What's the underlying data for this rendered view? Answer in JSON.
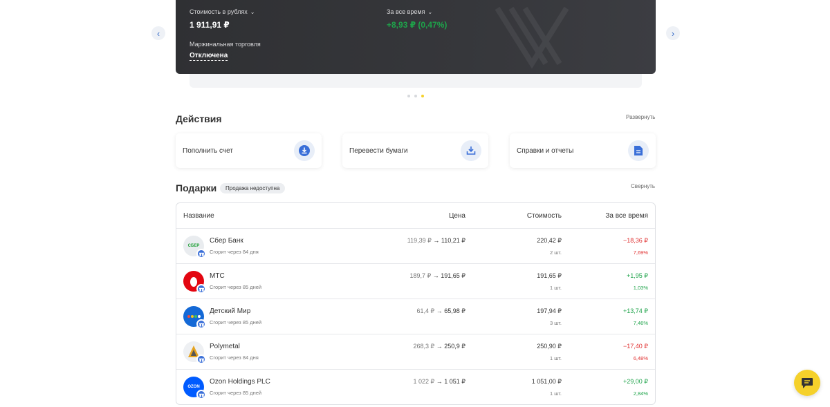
{
  "carousel": {
    "value_label": "Стоимость в рублях",
    "value": "1 911,91 ₽",
    "period_label": "За все время",
    "period_value": "+8,93 ₽ (0,47%)",
    "margin_label": "Маржинальная торговля",
    "margin_value": "Отключена",
    "active_slide": 3,
    "total_slides": 3
  },
  "actions": {
    "title": "Действия",
    "expand_label": "Развернуть",
    "items": [
      {
        "label": "Пополнить счет",
        "icon": "download-icon"
      },
      {
        "label": "Перевести бумаги",
        "icon": "transfer-in-icon"
      },
      {
        "label": "Справки и отчеты",
        "icon": "document-icon"
      }
    ]
  },
  "gifts": {
    "title": "Подарки",
    "badge": "Продажа недоступна",
    "collapse_label": "Свернуть",
    "columns": {
      "name": "Название",
      "price": "Цена",
      "cost": "Стоимость",
      "all_time": "За все время"
    },
    "rows": [
      {
        "name": "Сбер Банк",
        "sub": "Сгорит через 84 дня",
        "price_old": "119,39 ₽",
        "price_new": "110,21 ₽",
        "cost": "220,42 ₽",
        "qty": "2 шт.",
        "change": "−18,36 ₽",
        "pct": "7,69%",
        "trend": "neg",
        "logo_text": "СБЕР",
        "logo_bg": "#e9ecef",
        "logo_fg": "#21a038"
      },
      {
        "name": "МТС",
        "sub": "Сгорит через 85 дней",
        "price_old": "189,7 ₽",
        "price_new": "191,65 ₽",
        "cost": "191,65 ₽",
        "qty": "1 шт.",
        "change": "+1,95 ₽",
        "pct": "1,03%",
        "trend": "pos",
        "logo_text": "",
        "logo_bg": "#e30611",
        "logo_fg": "#ffffff"
      },
      {
        "name": "Детский Мир",
        "sub": "Сгорит через 85 дней",
        "price_old": "61,4 ₽",
        "price_new": "65,98 ₽",
        "cost": "197,94 ₽",
        "qty": "3 шт.",
        "change": "+13,74 ₽",
        "pct": "7,46%",
        "trend": "pos",
        "logo_text": "",
        "logo_bg": "#1469d6",
        "logo_fg": "#ffffff"
      },
      {
        "name": "Polymetal",
        "sub": "Сгорит через 84 дня",
        "price_old": "268,3 ₽",
        "price_new": "250,9 ₽",
        "cost": "250,90 ₽",
        "qty": "1 шт.",
        "change": "−17,40 ₽",
        "pct": "6,48%",
        "trend": "neg",
        "logo_text": "",
        "logo_bg": "#eef0f3",
        "logo_fg": "#e6a421"
      },
      {
        "name": "Ozon Holdings PLC",
        "sub": "Сгорит через 85 дней",
        "price_old": "1 022 ₽",
        "price_new": "1 051 ₽",
        "cost": "1 051,00 ₽",
        "qty": "1 шт.",
        "change": "+29,00 ₽",
        "pct": "2,84%",
        "trend": "pos",
        "logo_text": "OZON",
        "logo_bg": "#005bff",
        "logo_fg": "#ffffff"
      }
    ]
  },
  "colors": {
    "accent": "#f5d12b",
    "positive": "#1ea34a",
    "negative": "#e03131",
    "card_dark": "#333438"
  }
}
